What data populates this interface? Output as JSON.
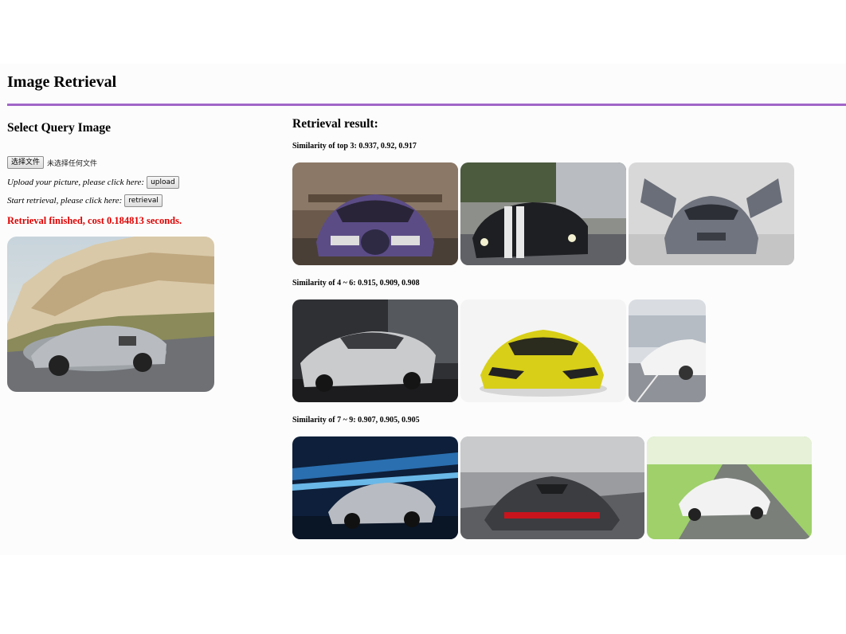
{
  "header": {
    "title": "Image Retrieval"
  },
  "left": {
    "heading": "Select Query Image",
    "choose_file_label": "选择文件",
    "file_status": "未选择任何文件",
    "upload_prompt": "Upload your picture, please click here:",
    "upload_label": "upload",
    "retrieval_prompt": "Start retrieval, please click here:",
    "retrieval_label": "retrieval",
    "status": "Retrieval finished, cost 0.184813 seconds."
  },
  "results": {
    "heading": "Retrieval result:",
    "groups": [
      {
        "label": "Similarity of top 3: 0.937, 0.92, 0.917"
      },
      {
        "label": "Similarity of 4 ~ 6: 0.915, 0.909, 0.908"
      },
      {
        "label": "Similarity of 7 ~ 9: 0.907, 0.905, 0.905"
      }
    ]
  },
  "colors": {
    "accent_rule": "#a066c8",
    "status_red": "#e00000"
  }
}
